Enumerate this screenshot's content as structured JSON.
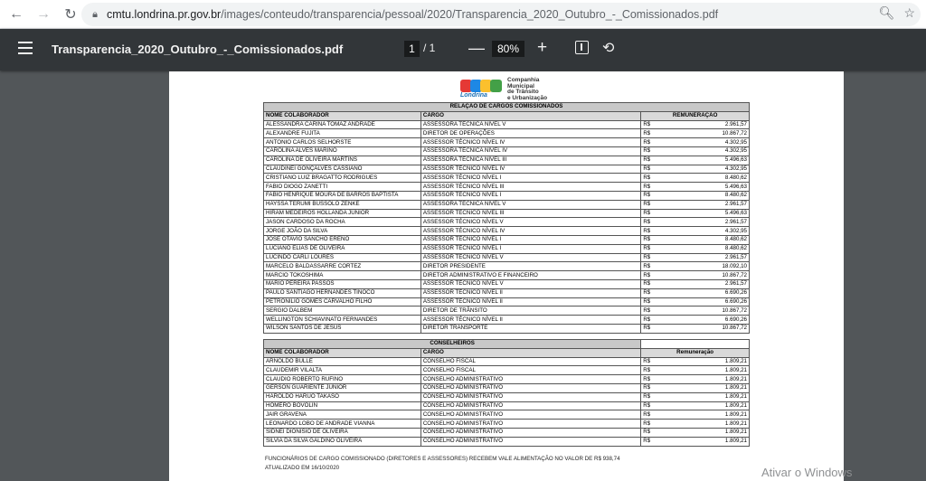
{
  "browser": {
    "url_host": "cmtu.londrina.pr.gov.br",
    "url_path": "/images/conteudo/transparencia/pessoal/2020/Transparencia_2020_Outubro_-_Comissionados.pdf"
  },
  "pdf_toolbar": {
    "title": "Transparencia_2020_Outubro_-_Comissionados.pdf",
    "page_current": "1",
    "page_sep": "/ 1",
    "zoom": "80%"
  },
  "logo": {
    "word": "Londrina",
    "line1": "Companhia",
    "line2": "Municipal",
    "line3": "de Trânsito",
    "line4": "e Urbanização"
  },
  "table1": {
    "title": "RELAÇÃO DE CARGOS COMISSIONADOS",
    "col_name": "NOME COLABORADOR",
    "col_cargo": "CARGO",
    "col_rem": "REMUNERAÇÃO",
    "rows": [
      {
        "name": "ALESSANDRA CARINA TOMAZ ANDRADE",
        "cargo": "ASSESSORA TÉCNICA NÍVEL V",
        "rs": "R$",
        "value": "2.961,57"
      },
      {
        "name": "ALEXANDRE FUJITA",
        "cargo": "DIRETOR DE OPERAÇÕES",
        "rs": "R$",
        "value": "10.867,72"
      },
      {
        "name": "ANTONIO CARLOS SELHORSTE",
        "cargo": "ASSESSOR TÉCNICO NÍVEL IV",
        "rs": "R$",
        "value": "4.302,95"
      },
      {
        "name": "CAROLINA ALVES MARINO",
        "cargo": "ASSESSORA TÉCNICA NÍVEL IV",
        "rs": "R$",
        "value": "4.302,95"
      },
      {
        "name": "CAROLINA DE OLIVEIRA MARTINS",
        "cargo": "ASSESSORA TÉCNICA NÍVEL III",
        "rs": "R$",
        "value": "5.496,63"
      },
      {
        "name": "CLAUDINEI GONÇALVES CASSIANO",
        "cargo": "ASSESSOR TÉCNICO NÍVEL IV",
        "rs": "R$",
        "value": "4.302,95"
      },
      {
        "name": "CRISTIANO LUIZ BRAGATTO RODRIGUES",
        "cargo": "ASSESSOR TÉCNICO NÍVEL I",
        "rs": "R$",
        "value": "8.480,62"
      },
      {
        "name": "FABIO DIOGO ZANETTI",
        "cargo": "ASSESSOR TÉCNICO NÍVEL III",
        "rs": "R$",
        "value": "5.496,63"
      },
      {
        "name": "FABIO HENRIQUE MOURA DE BARROS BAPTISTA",
        "cargo": "ASSESSOR TÉCNICO NÍVEL I",
        "rs": "R$",
        "value": "8.480,62"
      },
      {
        "name": "HAYSSA TERUMI BUSSOLO ZENKE",
        "cargo": "ASSESSORA TÉCNICA NÍVEL V",
        "rs": "R$",
        "value": "2.961,57"
      },
      {
        "name": "HIRAM MEDEIROS HOLLANDA JUNIOR",
        "cargo": "ASSESSOR TÉCNICO NÍVEL III",
        "rs": "R$",
        "value": "5.496,63"
      },
      {
        "name": "JASON CARDOSO DA ROCHA",
        "cargo": "ASSESSOR TÉCNICO NÍVEL V",
        "rs": "R$",
        "value": "2.961,57"
      },
      {
        "name": "JORGE JOÃO DA SILVA",
        "cargo": "ASSESSOR TÉCNICO NÍVEL IV",
        "rs": "R$",
        "value": "4.302,95"
      },
      {
        "name": "JOSE OTAVIO SANCHO ERENO",
        "cargo": "ASSESSOR TÉCNICO NÍVEL I",
        "rs": "R$",
        "value": "8.480,62"
      },
      {
        "name": "LUCIANO ELIAS DE OLIVEIRA",
        "cargo": "ASSESSOR TÉCNICO NÍVEL I",
        "rs": "R$",
        "value": "8.480,62"
      },
      {
        "name": "LUCINDO CARLI LOURES",
        "cargo": "ASSESSOR TÉCNICO NÍVEL V",
        "rs": "R$",
        "value": "2.961,57"
      },
      {
        "name": "MARCELO BALDASSARRE CORTEZ",
        "cargo": "DIRETOR PRESIDENTE",
        "rs": "R$",
        "value": "18.092,10"
      },
      {
        "name": "MARCIO TOKOSHIMA",
        "cargo": "DIRETOR ADMINISTRATIVO E FINANCEIRO",
        "rs": "R$",
        "value": "10.867,72"
      },
      {
        "name": "MARIO PEREIRA PASSOS",
        "cargo": "ASSESSOR TÉCNICO NÍVEL V",
        "rs": "R$",
        "value": "2.961,57"
      },
      {
        "name": "PAULO SANTIAGO HERNANDES TINOCO",
        "cargo": "ASSESSOR TÉCNICO NÍVEL II",
        "rs": "R$",
        "value": "6.690,26"
      },
      {
        "name": "PETRONILIO GOMES CARVALHO FILHO",
        "cargo": "ASSESSOR TÉCNICO NÍVEL II",
        "rs": "R$",
        "value": "6.690,26"
      },
      {
        "name": "SERGIO DALBEM",
        "cargo": "DIRETOR DE TRÂNSITO",
        "rs": "R$",
        "value": "10.867,72"
      },
      {
        "name": "WELLINGTON SCHIAVINATO FERNANDES",
        "cargo": "ASSESSOR TÉCNICO NÍVEL II",
        "rs": "R$",
        "value": "6.690,26"
      },
      {
        "name": "WILSON SANTOS DE JESUS",
        "cargo": "DIRETOR TRANSPORTE",
        "rs": "R$",
        "value": "10.867,72"
      }
    ]
  },
  "table2": {
    "title": "CONSELHEIROS",
    "col_name": "NOME COLABORADOR",
    "col_cargo": "CARGO",
    "col_rem": "Remuneração",
    "rows": [
      {
        "name": "ARNOLDO BULLE",
        "cargo": "CONSELHO FISCAL",
        "rs": "R$",
        "value": "1.809,21"
      },
      {
        "name": "CLAUDEMIR VILALTA",
        "cargo": "CONSELHO FISCAL",
        "rs": "R$",
        "value": "1.809,21"
      },
      {
        "name": "CLAUDIO ROBERTO RUFINO",
        "cargo": "CONSELHO ADMINISTRATIVO",
        "rs": "R$",
        "value": "1.809,21"
      },
      {
        "name": "GERSON GUARIENTE JUNIOR",
        "cargo": "CONSELHO ADMINISTRATIVO",
        "rs": "R$",
        "value": "1.809,21"
      },
      {
        "name": "HAROLDO HARUO TAKASO",
        "cargo": "CONSELHO ADMINISTRATIVO",
        "rs": "R$",
        "value": "1.809,21"
      },
      {
        "name": "HOMERO BOVOLIN",
        "cargo": "CONSELHO ADMINISTRATIVO",
        "rs": "R$",
        "value": "1.809,21"
      },
      {
        "name": "JAIR GRAVENA",
        "cargo": "CONSELHO ADMINISTRATIVO",
        "rs": "R$",
        "value": "1.809,21"
      },
      {
        "name": "LEONARDO LOBO DE ANDRADE VIANNA",
        "cargo": "CONSELHO ADMINISTRATIVO",
        "rs": "R$",
        "value": "1.809,21"
      },
      {
        "name": "SIDNEI DIONISIO DE OLIVEIRA",
        "cargo": "CONSELHO ADMINISTRATIVO",
        "rs": "R$",
        "value": "1.809,21"
      },
      {
        "name": "SILVIA DA SILVA GALDINO OLIVEIRA",
        "cargo": "CONSELHO ADMINISTRATIVO",
        "rs": "R$",
        "value": "1.809,21"
      }
    ]
  },
  "footnote": {
    "line1": "FUNCIONÁRIOS DE CARGO COMISSIONADO (DIRETORES E ASSESSORES) RECEBEM VALE ALIMENTAÇÃO NO VALOR DE R$ 938,74",
    "line2": "ATUALIZADO EM 16/10/2020"
  },
  "watermark": "Ativar o Windows",
  "colors": {
    "toolbar": "#323639",
    "viewer_bg": "#525659",
    "logo_c1": "#e53935",
    "logo_m": "#1e88e5",
    "logo_t": "#fbc02d",
    "logo_u": "#43a047"
  }
}
